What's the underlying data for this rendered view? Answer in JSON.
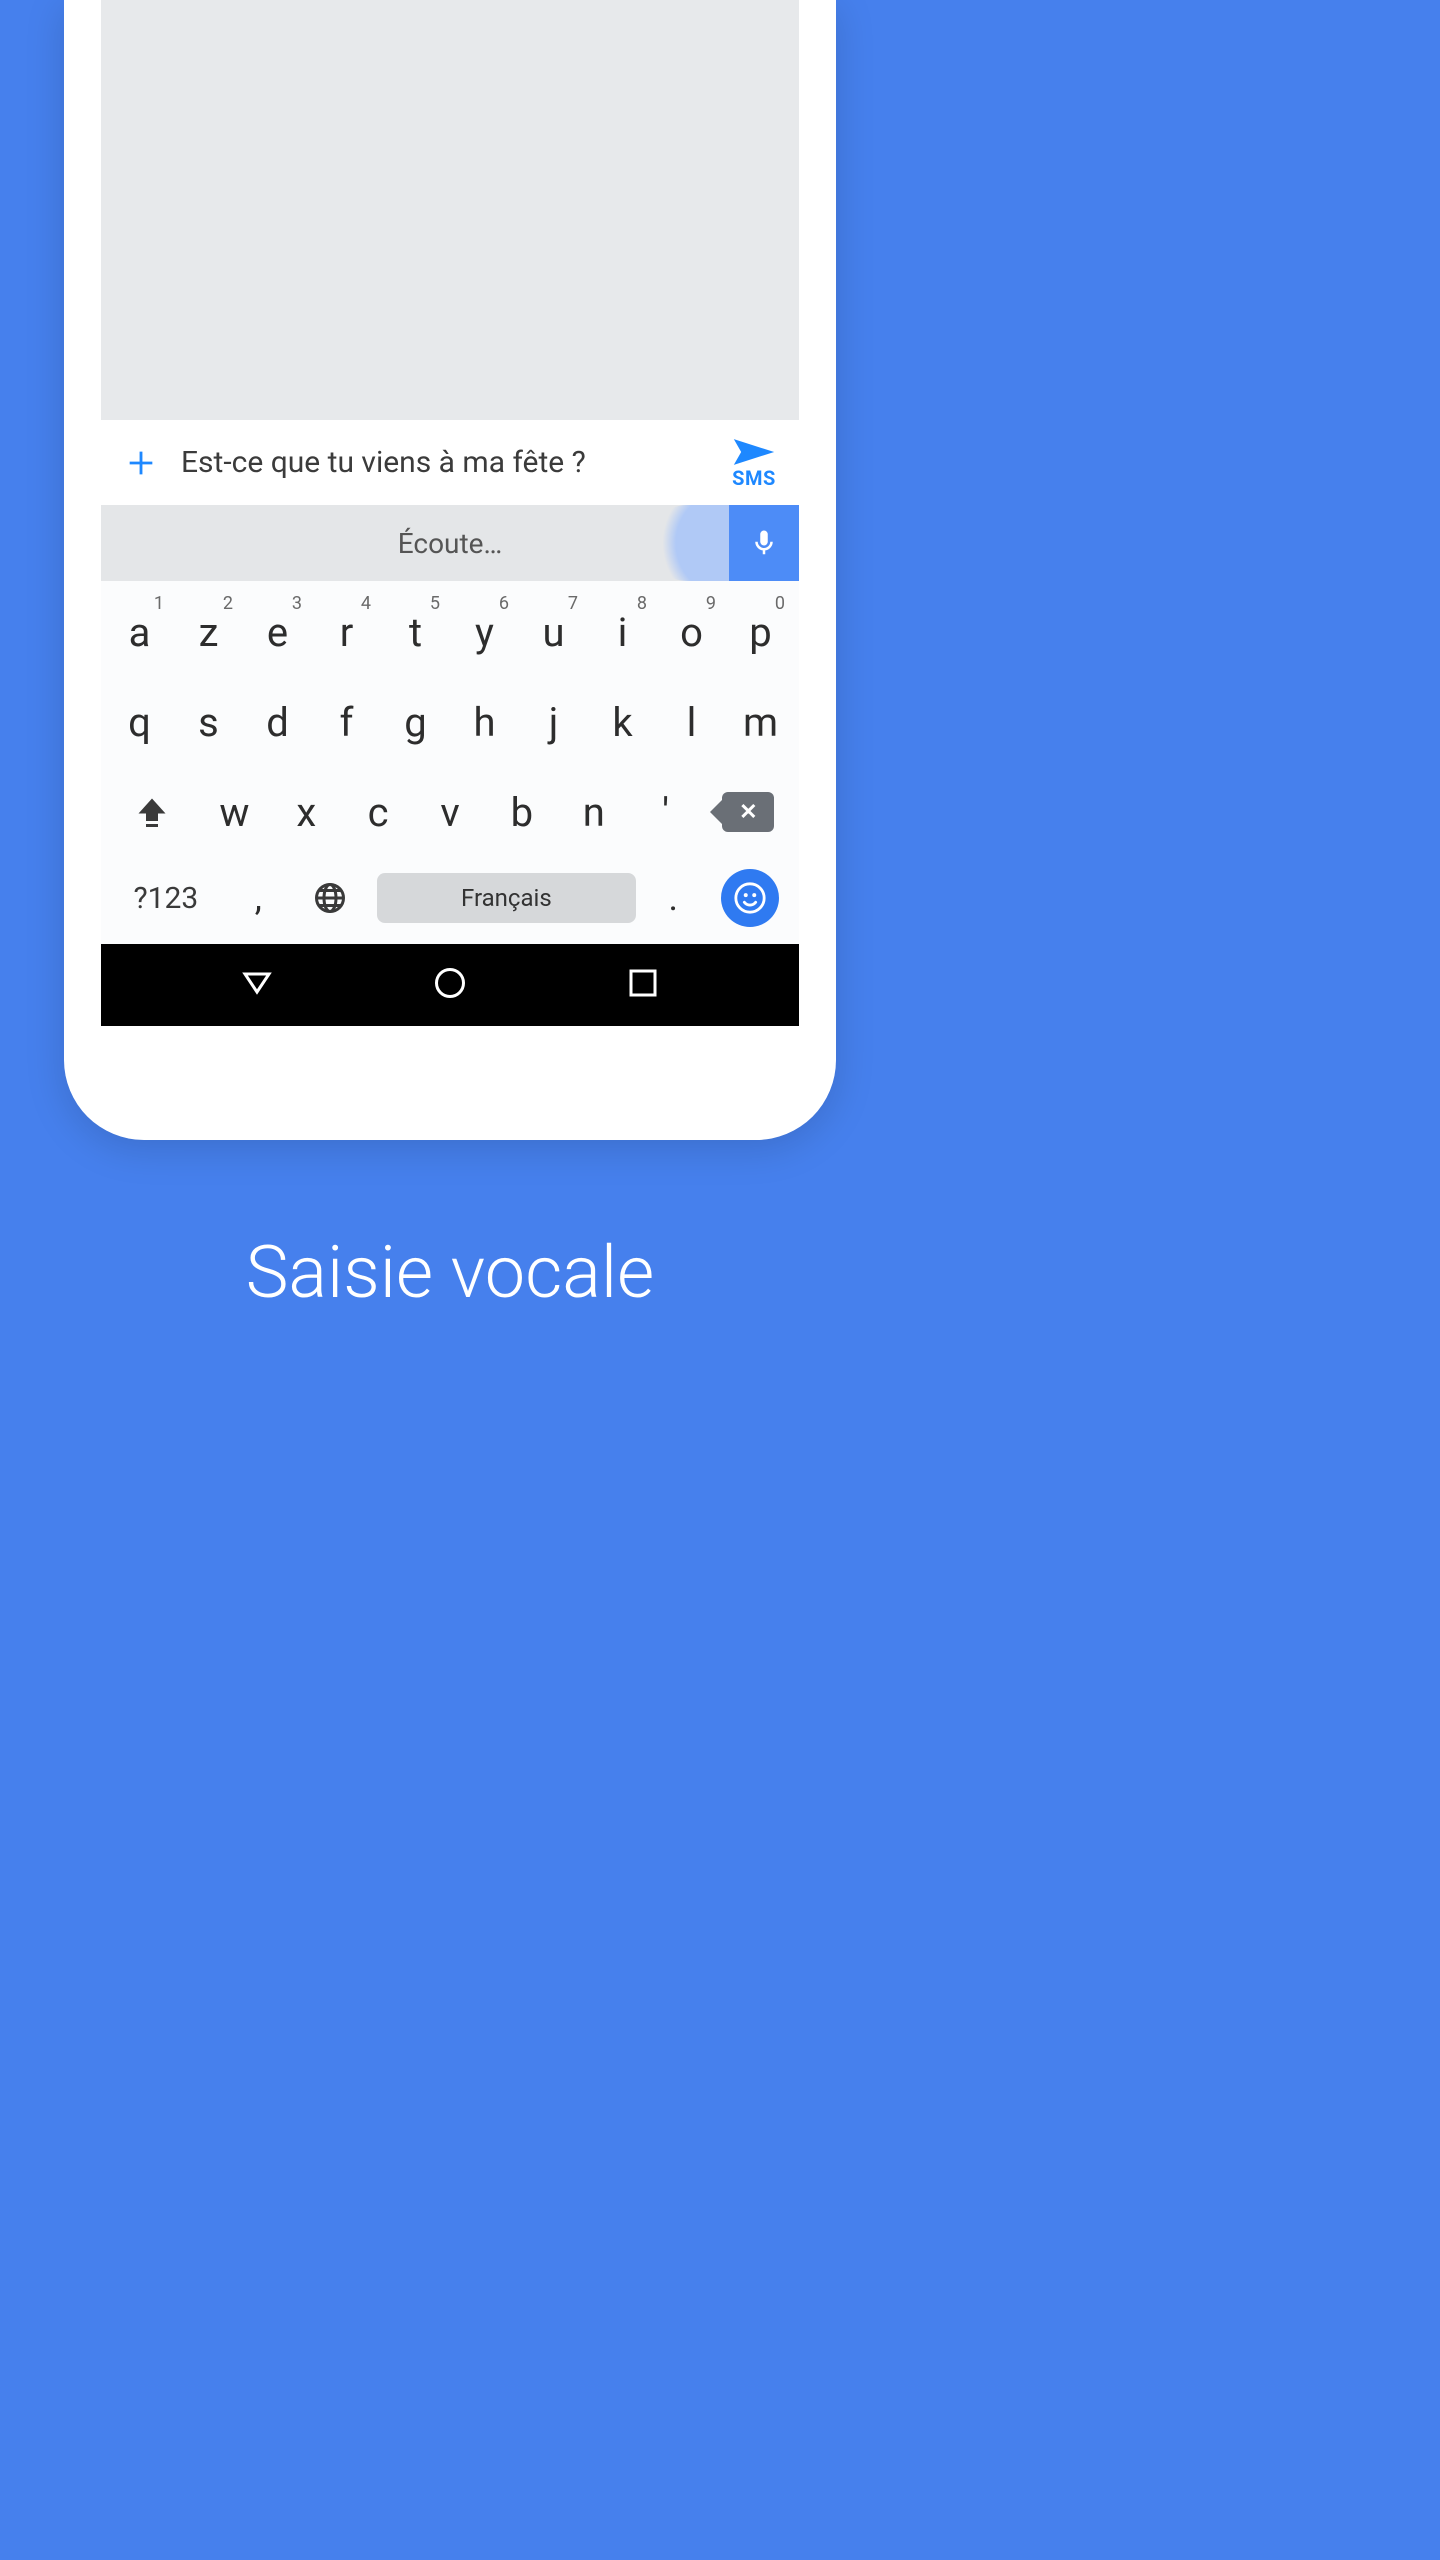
{
  "compose": {
    "text": "Est-ce que tu viens à ma fête ?",
    "send_label": "SMS"
  },
  "voice_bar": {
    "listening_label": "Écoute…"
  },
  "keyboard": {
    "row1": [
      {
        "main": "a",
        "sup": "1"
      },
      {
        "main": "z",
        "sup": "2"
      },
      {
        "main": "e",
        "sup": "3"
      },
      {
        "main": "r",
        "sup": "4"
      },
      {
        "main": "t",
        "sup": "5"
      },
      {
        "main": "y",
        "sup": "6"
      },
      {
        "main": "u",
        "sup": "7"
      },
      {
        "main": "i",
        "sup": "8"
      },
      {
        "main": "o",
        "sup": "9"
      },
      {
        "main": "p",
        "sup": "0"
      }
    ],
    "row2": [
      "q",
      "s",
      "d",
      "f",
      "g",
      "h",
      "j",
      "k",
      "l",
      "m"
    ],
    "row3": [
      "w",
      "x",
      "c",
      "v",
      "b",
      "n",
      "'"
    ],
    "symbols_label": "?123",
    "space_label": "Français",
    "punct_comma": ",",
    "punct_dot": "."
  },
  "caption": "Saisie vocale"
}
